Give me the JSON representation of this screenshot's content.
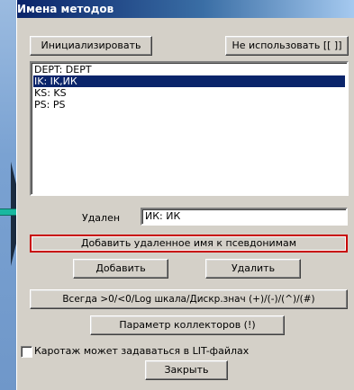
{
  "window": {
    "title": "Имена методов"
  },
  "buttons": {
    "init": "Инициализировать",
    "not_use": "Не использовать [[ ]]",
    "add_remote": "Добавить удаленное имя к псевдонимам",
    "add": "Добавить",
    "delete": "Удалить",
    "always": "Всегда >0/<0/Log шкала/Дискр.знач  (+)/(-)/(^)/(#)",
    "collectors": "Параметр коллекторов (!)",
    "close": "Закрыть"
  },
  "list": {
    "items": [
      {
        "text": "DEPT: DEPT",
        "selected": false
      },
      {
        "text": "IK: IK,ИК",
        "selected": true
      },
      {
        "text": "KS: KS",
        "selected": false
      },
      {
        "text": "PS: PS",
        "selected": false
      }
    ]
  },
  "removed": {
    "label": "Удален",
    "value": "ИК: ИК"
  },
  "checkbox": {
    "label": "Каротаж может задаваться в LIT-файлах",
    "checked": false
  }
}
